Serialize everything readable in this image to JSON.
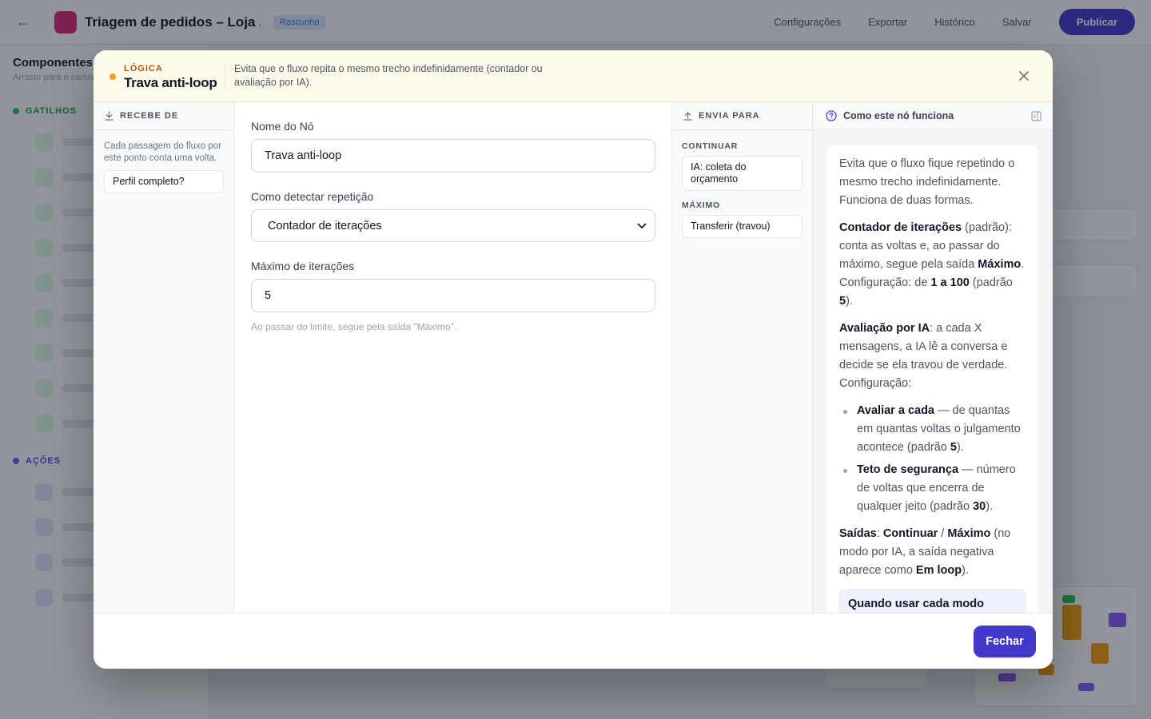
{
  "background": {
    "title": "Triagem de pedidos – Loja ...",
    "badge": "Rascunho",
    "actions": [
      "Configurações",
      "Exportar",
      "Histórico",
      "Salvar"
    ],
    "publish": "Publicar",
    "sidebar_title": "Componentes",
    "sidebar_subtitle": "Arraste para o canvas",
    "section_1": "GATILHOS",
    "section_2": "AÇÕES"
  },
  "modal": {
    "kicker": "LÓGICA",
    "title": "Trava anti-loop",
    "description": "Evita que o fluxo repita o mesmo trecho indefinidamente (contador ou avaliação por IA).",
    "close_icon": "close-icon"
  },
  "incoming": {
    "header": "RECEBE DE",
    "note": "Cada passagem do fluxo por este ponto conta uma volta.",
    "items": [
      "Perfil completo?"
    ]
  },
  "form": {
    "name_label": "Nome do Nó",
    "name_value": "Trava anti-loop",
    "detect_label": "Como detectar repetição",
    "detect_value": "Contador de iterações",
    "max_label": "Máximo de iterações",
    "max_value": "5",
    "max_help": "Ao passar do limite, segue pela saída \"Máximo\"."
  },
  "outgoing": {
    "header": "ENVIA PARA",
    "continue_label": "CONTINUAR",
    "continue_target": "IA: coleta do orçamento",
    "max_label": "MÁXIMO",
    "max_target": "Transferir (travou)"
  },
  "help": {
    "header": "Como este nó funciona",
    "intro": "Evita que o fluxo fique repetindo o mesmo trecho indefinidamente. Funciona de duas formas.",
    "counter_title": "Contador de iterações",
    "counter_default": "(padrão)",
    "counter_text_1": ": conta as voltas e, ao passar do máximo, segue pela saída ",
    "counter_max": "Máximo",
    "counter_text_2": ". Configuração: de ",
    "counter_range": "1 a 100",
    "counter_text_3": " (padrão ",
    "counter_default_value": "5",
    "counter_text_4": ").",
    "ai_title": "Avaliação por IA",
    "ai_text": ": a cada X mensagens, a IA lê a conversa e decide se ela travou de verdade. Configuração:",
    "bullet1_title": "Avaliar a cada",
    "bullet1_text": " — de quantas em quantas voltas o julgamento acontece (padrão ",
    "bullet1_value": "5",
    "bullet1_end": ").",
    "bullet2_title": "Teto de segurança",
    "bullet2_text": " — número de voltas que encerra de qualquer jeito (padrão ",
    "bullet2_value": "30",
    "bullet2_end": ").",
    "outputs_title": "Saídas",
    "outputs_sep": ": ",
    "out_continue": "Continuar",
    "out_slash": " / ",
    "out_max": "Máximo",
    "outputs_text": " (no modo por IA, a saída negativa aparece como ",
    "out_loop": "Em loop",
    "outputs_end": ").",
    "box_title": "Quando usar cada modo"
  },
  "footer": {
    "close_label": "Fechar"
  },
  "colors": {
    "accent": "#4338ca",
    "logic": "#b45309",
    "logic_dot": "#f59e0b",
    "header_bg": "#fffbeb"
  }
}
